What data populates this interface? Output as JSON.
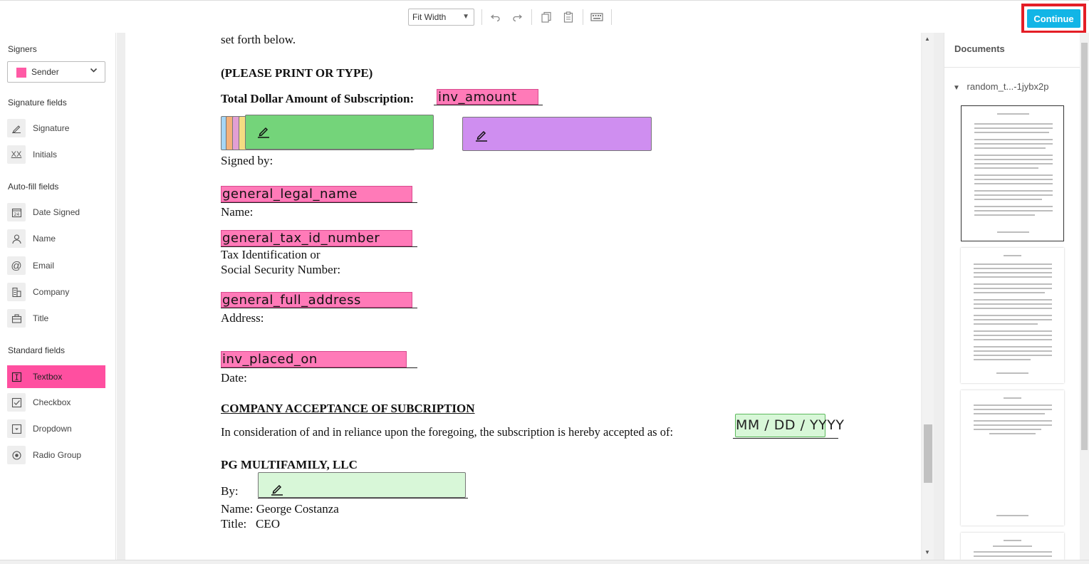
{
  "toolbar": {
    "zoom_value": "Fit Width",
    "continue_label": "Continue",
    "icons": [
      "undo-icon",
      "redo-icon",
      "copy-icon",
      "paste-icon",
      "keyboard-icon"
    ]
  },
  "sidebar": {
    "signers_title": "Signers",
    "signer_selected": "Sender",
    "signer_color": "#ff5aa5",
    "signature_fields_title": "Signature fields",
    "signature_fields": [
      {
        "label": "Signature",
        "icon": "pen-icon"
      },
      {
        "label": "Initials",
        "icon": "initials-icon"
      }
    ],
    "autofill_title": "Auto-fill fields",
    "autofill_fields": [
      {
        "label": "Date Signed",
        "icon": "calendar-icon"
      },
      {
        "label": "Name",
        "icon": "person-icon"
      },
      {
        "label": "Email",
        "icon": "at-icon"
      },
      {
        "label": "Company",
        "icon": "building-icon"
      },
      {
        "label": "Title",
        "icon": "briefcase-icon"
      }
    ],
    "standard_title": "Standard fields",
    "standard_fields": [
      {
        "label": "Textbox",
        "icon": "textbox-icon",
        "active": true
      },
      {
        "label": "Checkbox",
        "icon": "checkbox-icon"
      },
      {
        "label": "Dropdown",
        "icon": "dropdown-icon"
      },
      {
        "label": "Radio Group",
        "icon": "radio-icon"
      }
    ]
  },
  "document": {
    "line_setforth": "set forth below.",
    "print_heading": "(PLEASE PRINT OR TYPE)",
    "total_label": "Total Dollar Amount of Subscription:",
    "field_inv_amount": "inv_amount",
    "signed_by": "Signed by:",
    "field_legal_name": "general_legal_name",
    "name_label": "Name:",
    "field_tax_id": "general_tax_id_number",
    "tax_label_1": "Tax Identification or",
    "tax_label_2": "Social Security Number:",
    "field_address": "general_full_address",
    "address_label": "Address:",
    "field_placed_on": "inv_placed_on",
    "date_label": "Date:",
    "acceptance_heading": "COMPANY ACCEPTANCE OF SUBCRIPTION",
    "acceptance_text": "In consideration of and in reliance upon the foregoing, the subscription is hereby accepted as of:",
    "date_placeholder": "MM / DD / YYYY",
    "company_name": "PG MULTIFAMILY, LLC",
    "by_label": "By:",
    "name_line": "Name: George Costanza",
    "title_line": "Title:   CEO"
  },
  "right_panel": {
    "title": "Documents",
    "doc_name": "random_t...-1jybx2p"
  }
}
